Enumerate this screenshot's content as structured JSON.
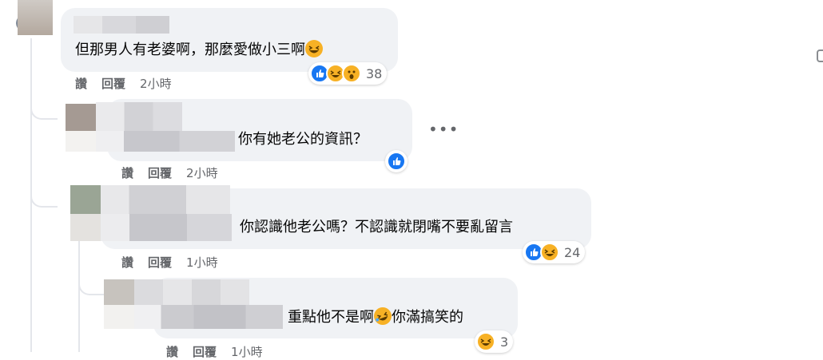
{
  "comments": [
    {
      "text": "但那男人有老婆啊，那麼愛做小三啊",
      "emoji_name": "grinning-squint-emoji",
      "time": "2小時",
      "reaction_count": "38",
      "reactions": [
        "like-icon",
        "haha-icon",
        "wow-icon"
      ]
    },
    {
      "text": "你有她老公的資訊？",
      "time": "2小時",
      "reactions": [
        "like-icon"
      ]
    },
    {
      "text": "你認識他老公嗎？不認識就閉嘴不要亂留言",
      "time": "1小時",
      "reaction_count": "24",
      "reactions": [
        "like-icon",
        "haha-icon"
      ]
    },
    {
      "text_before": "重點他不是啊",
      "emoji_name": "rolling-laughing-emoji",
      "text_after": "你滿搞笑的",
      "time": "1小時",
      "reaction_count": "3",
      "reactions": [
        "haha-icon"
      ]
    }
  ],
  "actions": {
    "like": "讚",
    "reply": "回覆"
  },
  "colors": {
    "bubble": "#f0f2f5",
    "like": "#1877f2",
    "haha": "#f7b125",
    "meta": "#65676b"
  }
}
